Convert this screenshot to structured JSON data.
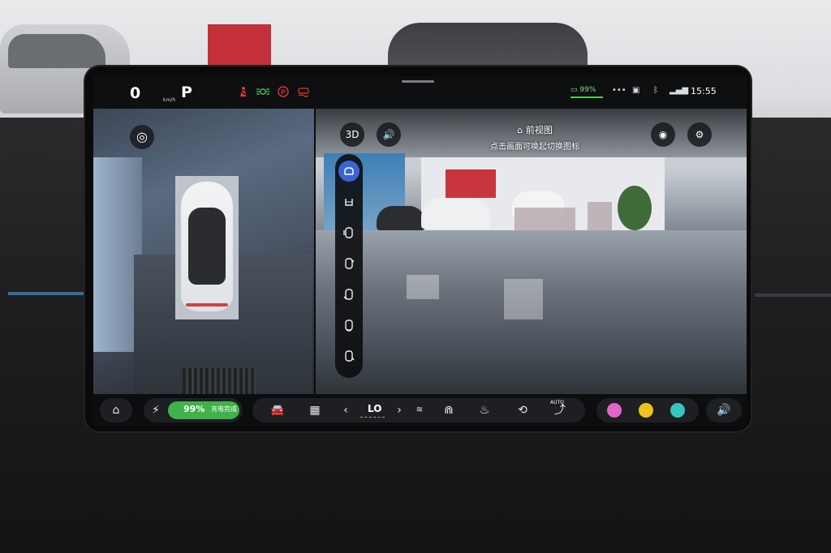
{
  "status_bar": {
    "speed": "0",
    "speed_unit": "km/h",
    "gear": "P",
    "warning_icons": [
      "seatbelt-warning-icon",
      "lights-icon",
      "parking-brake-icon",
      "stability-control-icon"
    ],
    "battery": "99%",
    "more": "•••",
    "time": "15:55"
  },
  "camera": {
    "left_controls": {
      "steering_icon": "◎"
    },
    "right_controls": {
      "mode_3d": "3D",
      "sound_icon": "🔊",
      "radar_icon": "◉",
      "settings_icon": "⚙"
    },
    "view_title": "前视图",
    "view_hint": "点击画面可唤起切换图标",
    "view_options": [
      "front",
      "front-wheels",
      "side-left",
      "side-right",
      "rear-left",
      "rear",
      "rear-wheels"
    ]
  },
  "dock": {
    "battery_percent": "99%",
    "charge_status": "充电完成",
    "climate_temp": "LO",
    "auto_label": "AUTO"
  },
  "colors": {
    "accent_green": "#3fb24a",
    "view_active": "#3a63d8",
    "warning_red": "#e0362f",
    "indicator_green": "#4cc94a"
  }
}
